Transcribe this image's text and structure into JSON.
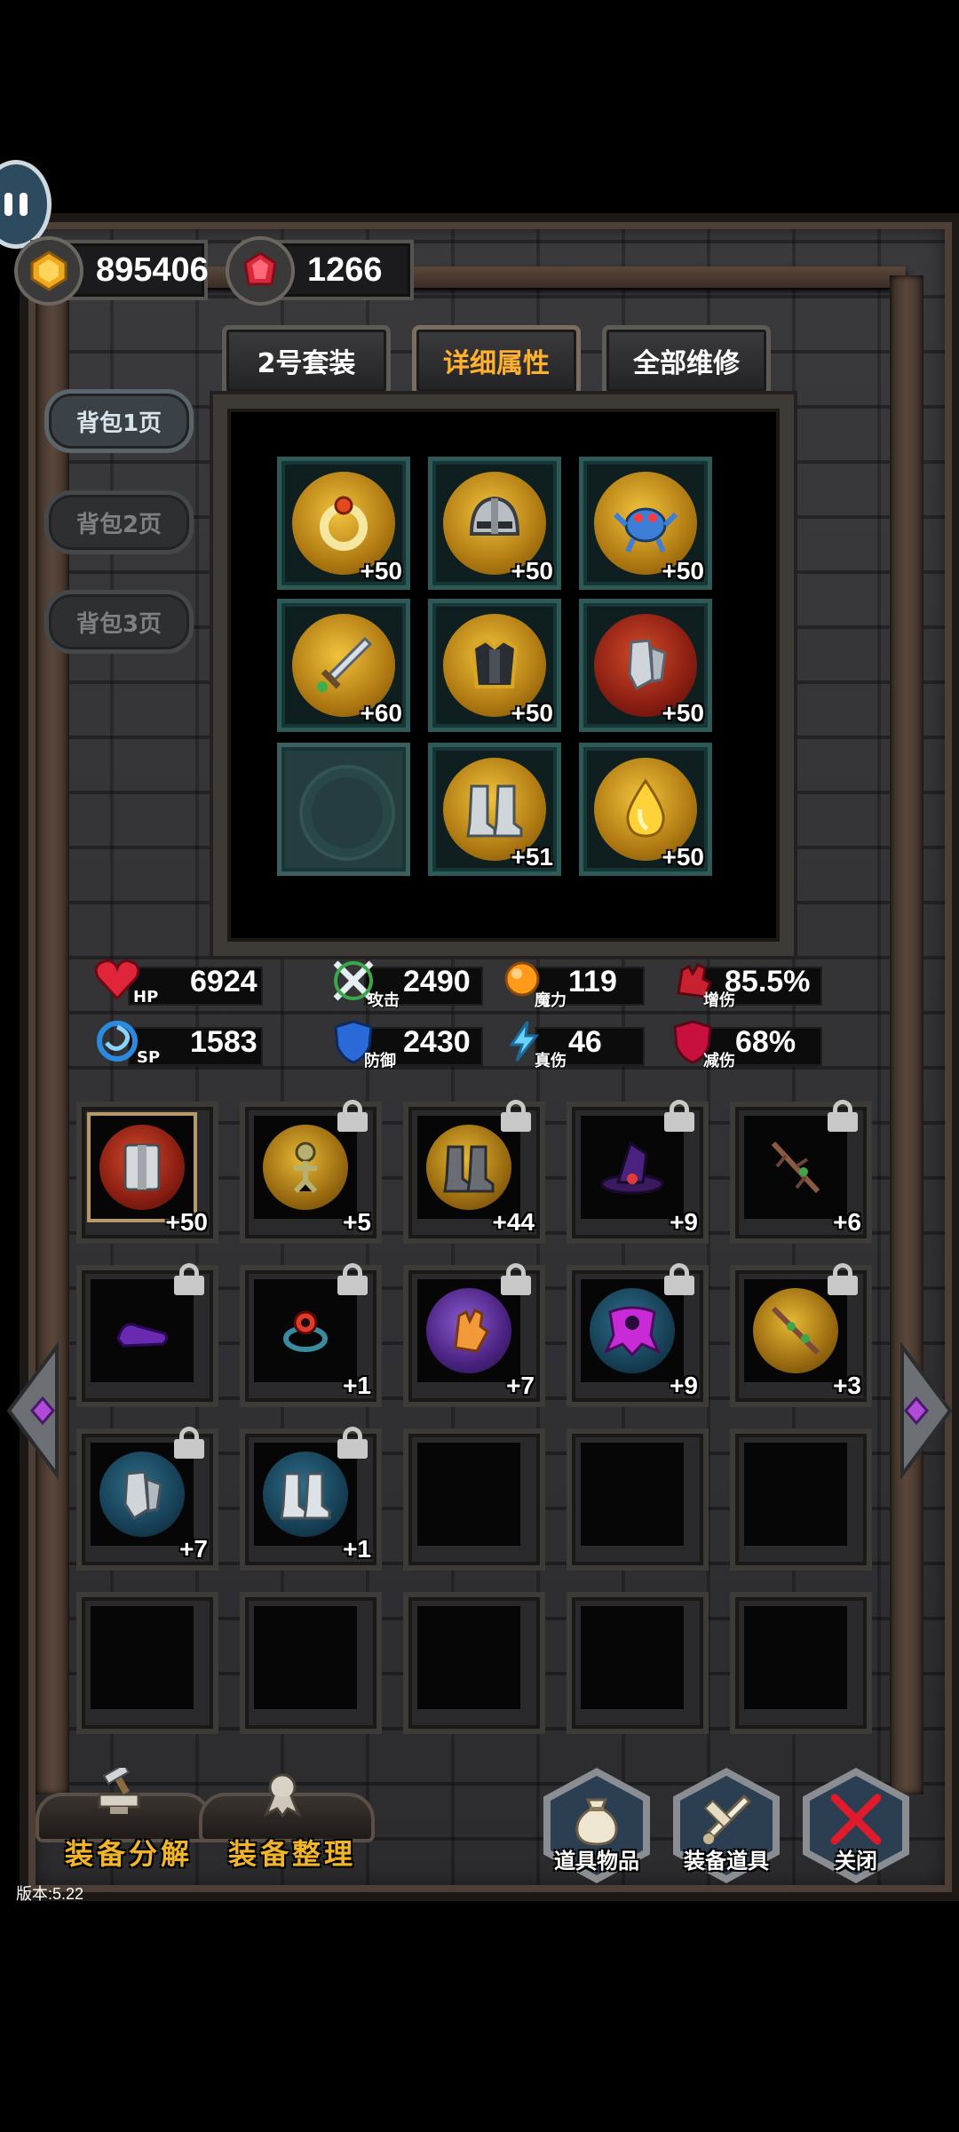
{
  "currency": {
    "gold": {
      "icon": "gold-coin-icon",
      "value": "895406"
    },
    "gem": {
      "icon": "red-gem-icon",
      "value": "1266"
    }
  },
  "tabs": [
    {
      "label": "2号套装",
      "active": false
    },
    {
      "label": "详细属性",
      "active": true
    },
    {
      "label": "全部维修",
      "active": false
    }
  ],
  "pages": [
    {
      "label": "背包1页",
      "active": true
    },
    {
      "label": "背包2页",
      "active": false
    },
    {
      "label": "背包3页",
      "active": false
    }
  ],
  "equipped": [
    {
      "icon": "ring-icon",
      "level": "+50"
    },
    {
      "icon": "helmet-icon",
      "level": "+50"
    },
    {
      "icon": "pet-crab-icon",
      "level": "+50"
    },
    {
      "icon": "sword-icon",
      "level": "+60"
    },
    {
      "icon": "chest-armor-icon",
      "level": "+50"
    },
    {
      "icon": "gauntlet-icon",
      "level": "+50"
    },
    {
      "icon": "empty-rune-slot-icon",
      "level": ""
    },
    {
      "icon": "boots-icon",
      "level": "+51"
    },
    {
      "icon": "gold-drop-icon",
      "level": "+50"
    }
  ],
  "stats": {
    "hp": {
      "icon": "heart-icon",
      "label": "HP",
      "value": "6924"
    },
    "attack": {
      "icon": "crossed-swords-icon",
      "label": "攻击",
      "value": "2490"
    },
    "magic": {
      "icon": "magic-orb-icon",
      "label": "魔力",
      "value": "119"
    },
    "dmg_up": {
      "icon": "red-fist-icon",
      "label": "增伤",
      "value": "85.5%"
    },
    "sp": {
      "icon": "vortex-icon",
      "label": "SP",
      "value": "1583"
    },
    "defense": {
      "icon": "shield-icon",
      "label": "防御",
      "value": "2430"
    },
    "true_dmg": {
      "icon": "lightning-icon",
      "label": "真伤",
      "value": "46"
    },
    "dmg_down": {
      "icon": "red-shield-icon",
      "label": "减伤",
      "value": "68%"
    }
  },
  "inventory": [
    {
      "icon": "gauntlet-shield-icon",
      "level": "+50",
      "locked": false,
      "bg": "red",
      "selected": true
    },
    {
      "icon": "skeleton-icon",
      "level": "+5",
      "locked": true,
      "bg": "gold"
    },
    {
      "icon": "iron-boots-icon",
      "level": "+44",
      "locked": true,
      "bg": "gold"
    },
    {
      "icon": "witch-hat-icon",
      "level": "+9",
      "locked": true,
      "bg": "none"
    },
    {
      "icon": "branch-staff-icon",
      "level": "+6",
      "locked": true,
      "bg": "none"
    },
    {
      "icon": "purple-slippers-icon",
      "level": "",
      "locked": true,
      "bg": "none"
    },
    {
      "icon": "ring-of-eye-icon",
      "level": "+1",
      "locked": true,
      "bg": "none"
    },
    {
      "icon": "flame-glove-icon",
      "level": "+7",
      "locked": true,
      "bg": "purple"
    },
    {
      "icon": "magenta-cloak-icon",
      "level": "+9",
      "locked": true,
      "bg": "teal"
    },
    {
      "icon": "thorn-branch-icon",
      "level": "+3",
      "locked": true,
      "bg": "gold"
    },
    {
      "icon": "steel-gauntlet-icon",
      "level": "+7",
      "locked": true,
      "bg": "teal"
    },
    {
      "icon": "steel-boots-icon",
      "level": "+1",
      "locked": true,
      "bg": "teal"
    },
    {
      "icon": "",
      "level": "",
      "locked": false,
      "bg": "empty"
    },
    {
      "icon": "",
      "level": "",
      "locked": false,
      "bg": "empty"
    },
    {
      "icon": "",
      "level": "",
      "locked": false,
      "bg": "empty"
    },
    {
      "icon": "",
      "level": "",
      "locked": false,
      "bg": "empty"
    },
    {
      "icon": "",
      "level": "",
      "locked": false,
      "bg": "empty"
    },
    {
      "icon": "",
      "level": "",
      "locked": false,
      "bg": "empty"
    },
    {
      "icon": "",
      "level": "",
      "locked": false,
      "bg": "empty"
    },
    {
      "icon": "",
      "level": "",
      "locked": false,
      "bg": "empty"
    }
  ],
  "bottom": {
    "decompose": {
      "icon": "anvil-hammer-icon",
      "label": "装备分解"
    },
    "organize": {
      "icon": "ribbon-icon",
      "label": "装备整理"
    },
    "items": {
      "icon": "sack-icon",
      "label": "道具物品"
    },
    "equip_items": {
      "icon": "sword-scroll-icon",
      "label": "装备道具"
    },
    "close": {
      "icon": "red-x-icon",
      "label": "关闭"
    }
  },
  "version": "版本:5.22"
}
